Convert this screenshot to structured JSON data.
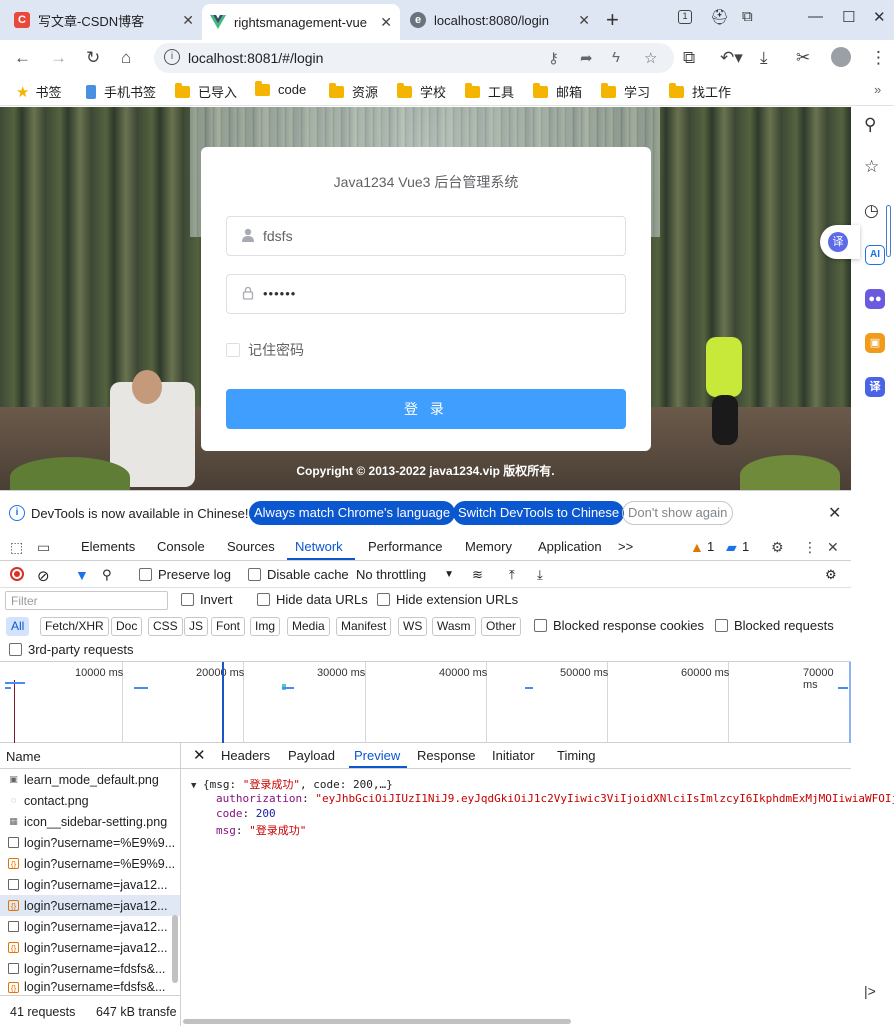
{
  "browser": {
    "tabs": [
      {
        "title": "写文章-CSDN博客",
        "favicon": "C",
        "favicon_color": "#e8493b"
      },
      {
        "title": "rightsmanagement-vue",
        "favicon": "V",
        "favicon_color": "#42b883"
      },
      {
        "title": "localhost:8080/login",
        "favicon": "e",
        "favicon_color": "#6b7280"
      }
    ],
    "new_tab": "+",
    "window": {
      "minimize": "—",
      "maximize": "☐",
      "close": "✕"
    },
    "url": "localhost:8081/#/login",
    "bookmarks": [
      "书签",
      "手机书签",
      "已导入",
      "code",
      "资源",
      "学校",
      "工具",
      "邮箱",
      "学习",
      "找工作"
    ]
  },
  "login": {
    "title": "Java1234 Vue3 后台管理系统",
    "username": "fdsfs",
    "password_mask": "••••••",
    "remember_label": "记住密码",
    "login_button": "登 录",
    "copyright": "Copyright © 2013-2022 java1234.vip 版权所有."
  },
  "sidebar": {
    "translate": "译",
    "ai": "AI",
    "translate2": "译",
    "expand": "|>"
  },
  "devtools": {
    "banner": {
      "message": "DevTools is now available in Chinese!",
      "btn1": "Always match Chrome's language",
      "btn2": "Switch DevTools to Chinese",
      "btn3": "Don't show again"
    },
    "tabs": [
      "Elements",
      "Console",
      "Sources",
      "Network",
      "Performance",
      "Memory",
      "Application"
    ],
    "more": ">>",
    "warnings": "1",
    "messages": "1",
    "toolbar": {
      "preserve_log": "Preserve log",
      "disable_cache": "Disable cache",
      "throttling": "No throttling"
    },
    "filter_placeholder": "Filter",
    "filter_options": [
      "Invert",
      "Hide data URLs",
      "Hide extension URLs"
    ],
    "types": [
      "All",
      "Fetch/XHR",
      "Doc",
      "CSS",
      "JS",
      "Font",
      "Img",
      "Media",
      "Manifest",
      "WS",
      "Wasm",
      "Other"
    ],
    "blocked": [
      "Blocked response cookies",
      "Blocked requests"
    ],
    "third_party": "3rd-party requests",
    "timeline_ticks": [
      "10000 ms",
      "20000 ms",
      "30000 ms",
      "40000 ms",
      "50000 ms",
      "60000 ms",
      "70000 ms"
    ],
    "name_header": "Name",
    "requests": [
      {
        "name": "learn_mode_default.png",
        "kind": "img"
      },
      {
        "name": "contact.png",
        "kind": "img2"
      },
      {
        "name": "icon__sidebar-setting.png",
        "kind": "img"
      },
      {
        "name": "login?username=%E9%9...",
        "kind": "doc"
      },
      {
        "name": "login?username=%E9%9...",
        "kind": "xhr"
      },
      {
        "name": "login?username=java12...",
        "kind": "doc"
      },
      {
        "name": "login?username=java12...",
        "kind": "xhr",
        "selected": true
      },
      {
        "name": "login?username=java12...",
        "kind": "doc"
      },
      {
        "name": "login?username=java12...",
        "kind": "xhr"
      },
      {
        "name": "login?username=fdsfs&...",
        "kind": "doc"
      },
      {
        "name": "login?username=fdsfs&...",
        "kind": "xhr"
      }
    ],
    "status": {
      "requests": "41 requests",
      "transferred": "647 kB transfe"
    },
    "detail_tabs": [
      "Headers",
      "Payload",
      "Preview",
      "Response",
      "Initiator",
      "Timing"
    ],
    "preview": {
      "summary_open": "{msg: ",
      "summary_msg": "\"登录成功\"",
      "summary_code": ", code: 200,…}",
      "auth_key": "authorization",
      "auth_val": "\"eyJhbGciOiJIUzI1NiJ9.eyJqdGkiOiJ1c2VyIiwic3ViIjoidXNlciIsImlzcyI6IkphdmExMjMOIiwiaWFOIjoxN",
      "code_key": "code",
      "code_val": "200",
      "msg_key": "msg",
      "msg_val": "\"登录成功\""
    }
  }
}
